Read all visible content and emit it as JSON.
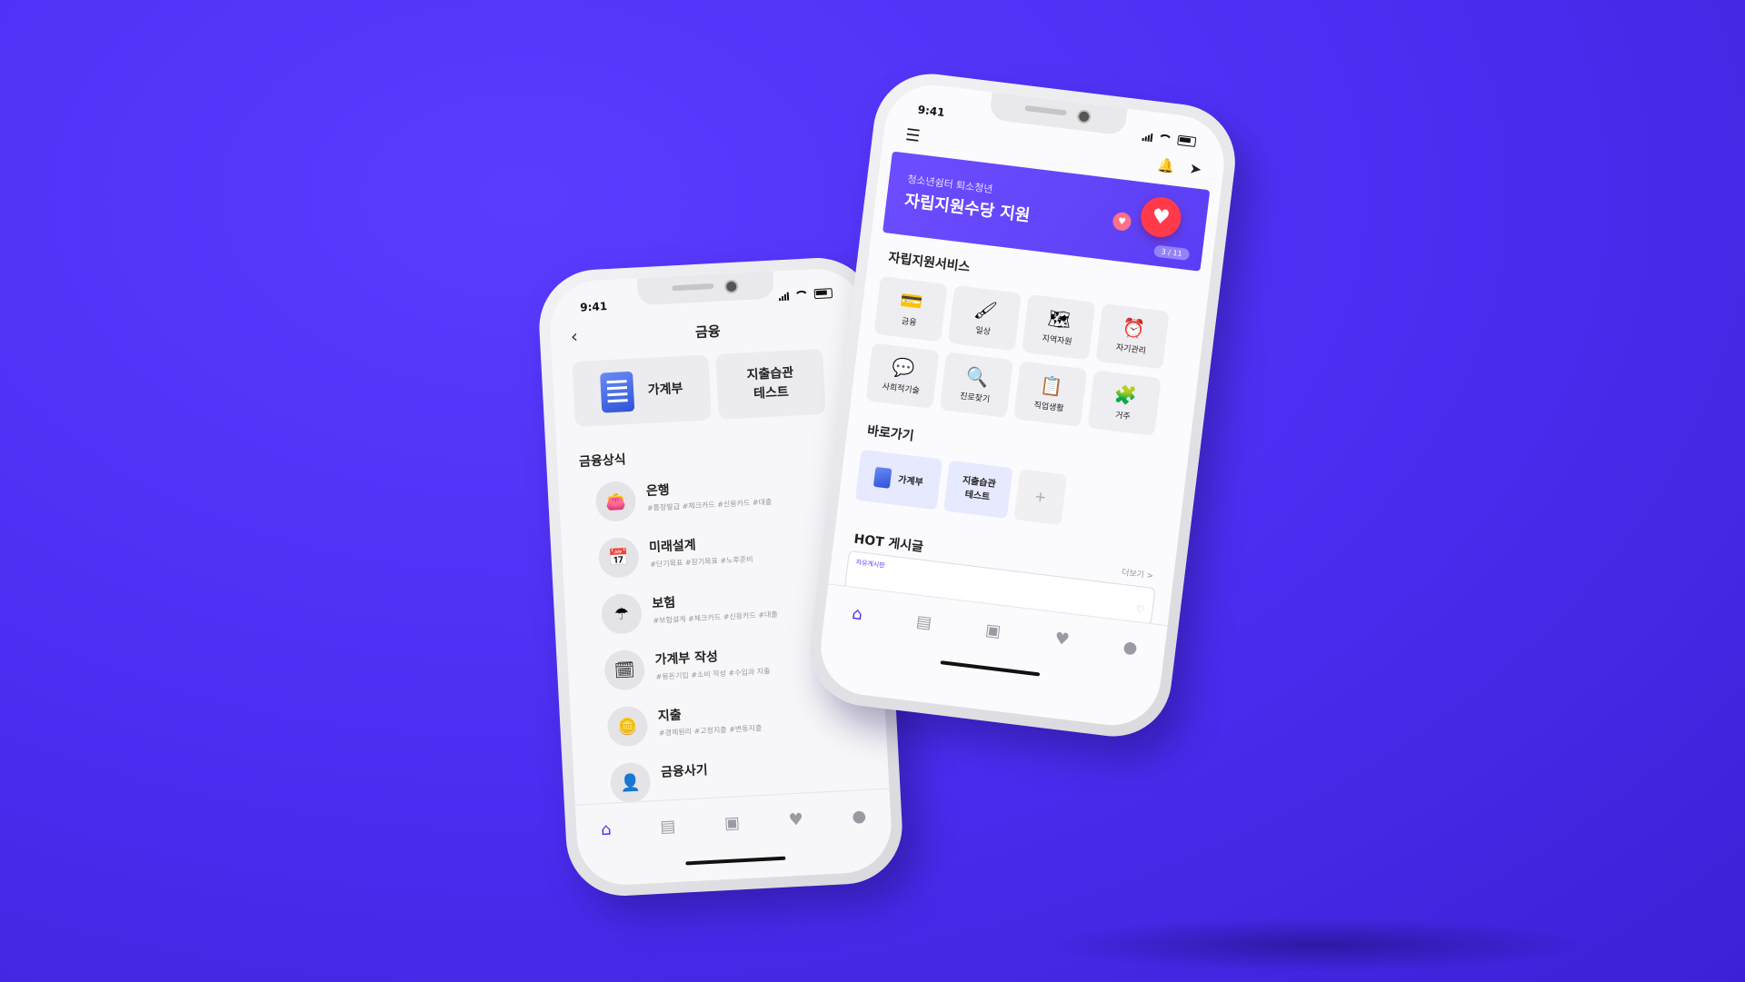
{
  "left_phone": {
    "status": {
      "time": "9:41"
    },
    "header": {
      "title": "금융",
      "back_icon": "chevron-left-icon"
    },
    "tiles": [
      {
        "label": "가계부",
        "icon": "document-icon"
      },
      {
        "label_line1": "지출습관",
        "label_line2": "테스트"
      }
    ],
    "section_title": "금융상식",
    "items": [
      {
        "title": "은행",
        "tags": "#통장발급  #체크카드  #신용카드  #대출",
        "icon": "wallet-icon"
      },
      {
        "title": "미래설계",
        "tags": "#단기목표  #장기목표  #노후준비",
        "icon": "calendar-icon"
      },
      {
        "title": "보험",
        "tags": "#보험설계  #체크카드  #신용카드  #대출",
        "icon": "umbrella-icon"
      },
      {
        "title": "가계부 작성",
        "tags": "#용돈기입  #소비 작성  #수입과 지출",
        "icon": "calendar-pen-icon"
      },
      {
        "title": "지출",
        "tags": "#경제원리  #고정지출  #변동지출",
        "icon": "coin-jar-icon"
      },
      {
        "title": "금융사기",
        "tags": "",
        "icon": "person-alert-icon"
      }
    ],
    "tabbar": [
      "home-icon",
      "document-icon",
      "contacts-icon",
      "heart-icon",
      "user-icon"
    ]
  },
  "right_phone": {
    "status": {
      "time": "9:41"
    },
    "banner": {
      "subtitle": "청소년쉼터 퇴소청년",
      "title": "자립지원수당 지원",
      "pager": "3 / 11"
    },
    "service_section_title": "자립지원서비스",
    "services": [
      {
        "label": "금융",
        "glyph": "💳"
      },
      {
        "label": "일상",
        "glyph": "🖌"
      },
      {
        "label": "지역자원",
        "glyph": "🗺"
      },
      {
        "label": "자기관리",
        "glyph": "⏰"
      },
      {
        "label": "사회적기술",
        "glyph": "💬"
      },
      {
        "label": "진로찾기",
        "glyph": "🔍"
      },
      {
        "label": "직업생활",
        "glyph": "📋"
      },
      {
        "label": "거주",
        "glyph": "🧩"
      }
    ],
    "shortcut_section_title": "바로가기",
    "shortcuts": {
      "first": "가계부",
      "second_line1": "지출습관",
      "second_line2": "테스트",
      "add": "+"
    },
    "hot_section_title": "HOT 게시글",
    "more_link": "더보기 >",
    "post_tag": "자유게시판",
    "tabbar": [
      "home-icon",
      "document-icon",
      "contacts-icon",
      "heart-icon",
      "user-icon"
    ]
  },
  "colors": {
    "background": "#4a2df0",
    "accent": "#4b35f0",
    "banner": "#6d4dff",
    "heart": "#ff3b4b"
  }
}
